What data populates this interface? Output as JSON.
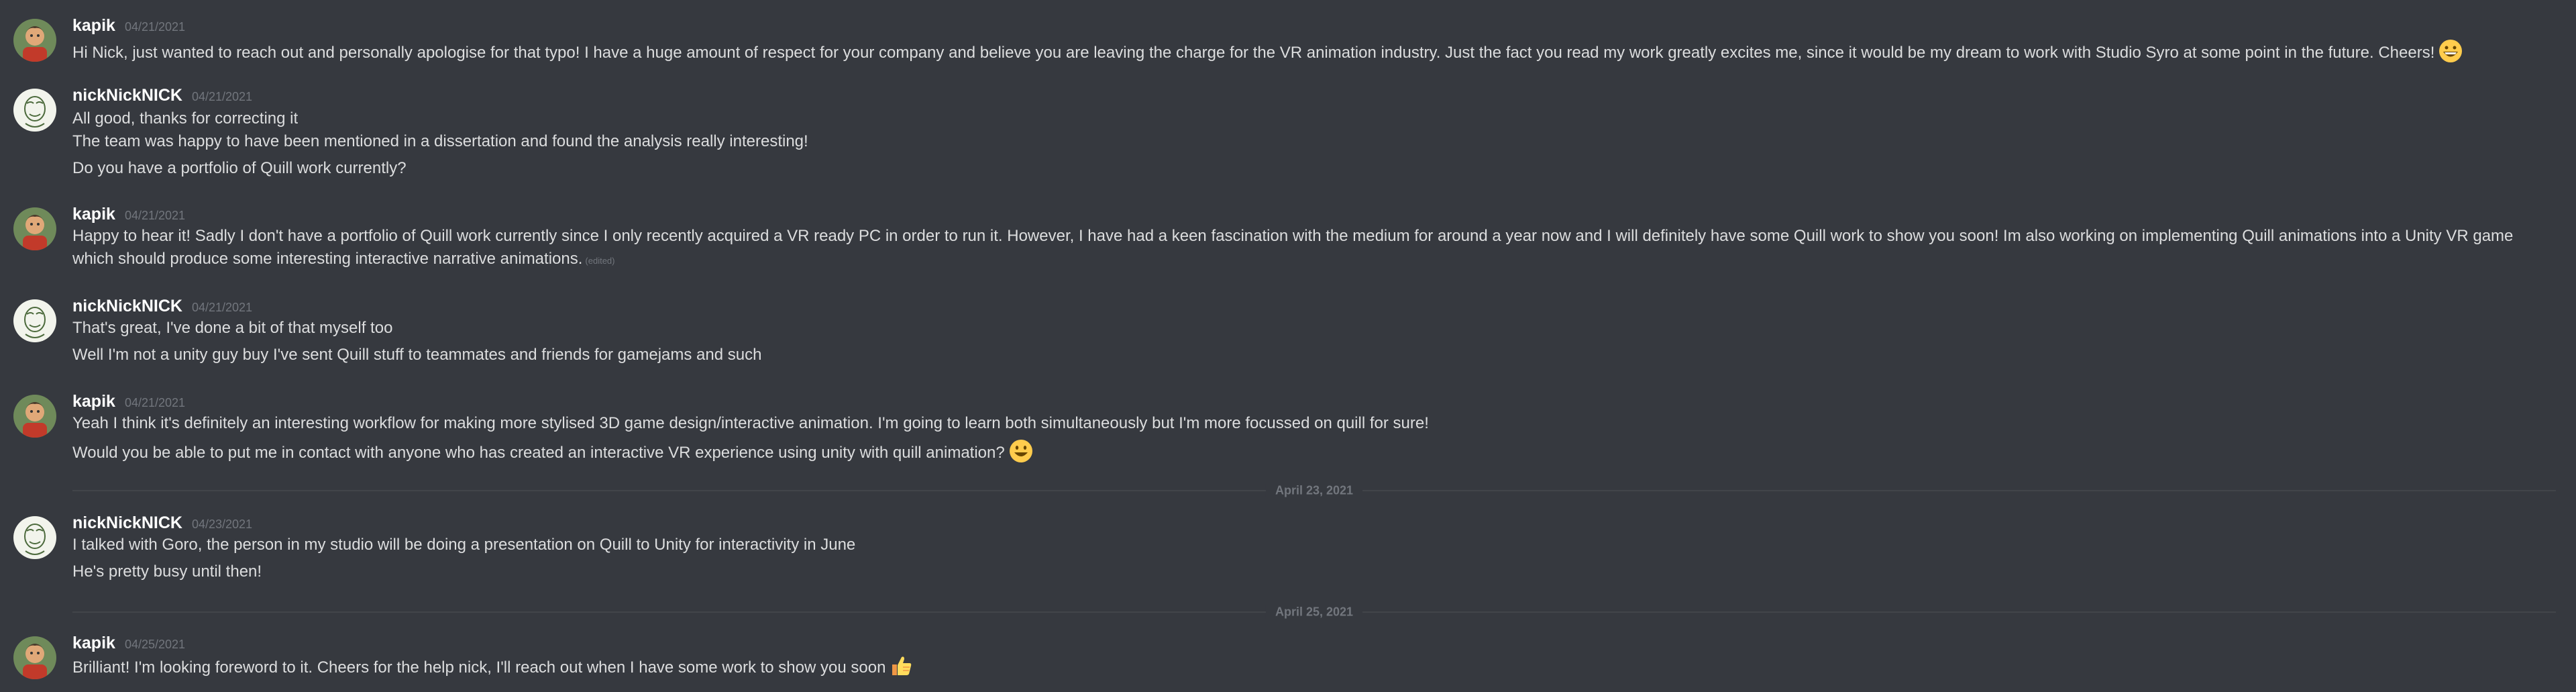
{
  "users": {
    "kapik": {
      "name": "kapik"
    },
    "nick": {
      "name": "nickNickNICK"
    }
  },
  "groups": [
    {
      "author": "kapik",
      "time": "04/21/2021",
      "lines": [
        "Hi Nick,  just wanted to reach out and personally apologise for that typo! I have a huge amount of respect for your company and believe you are leaving the charge for the VR animation industry. Just the fact you read my work greatly excites me, since it would be my dream to work with Studio Syro at some point in the future. Cheers!"
      ]
    },
    {
      "author": "nickNickNICK",
      "time": "04/21/2021",
      "lines": [
        "All good, thanks for correcting it",
        "The team was happy to have been mentioned in a dissertation and found the analysis really interesting!",
        "Do you have a portfolio of Quill work currently?"
      ]
    },
    {
      "author": "kapik",
      "time": "04/21/2021",
      "lines": [
        "Happy to hear it! Sadly I don't have a portfolio of Quill work currently since I only recently acquired a VR ready PC in order to run it. However, I have had a keen fascination with the medium for around a year now and I will definitely have some Quill work to show you soon! Im also working on implementing Quill animations into a Unity VR game which should produce some interesting interactive narrative animations."
      ],
      "edited": "(edited)"
    },
    {
      "author": "nickNickNICK",
      "time": "04/21/2021",
      "lines": [
        "That's great, I've done a bit of that myself too",
        "Well I'm not a unity guy buy I've sent Quill stuff to teammates and friends for gamejams and such"
      ]
    },
    {
      "author": "kapik",
      "time": "04/21/2021",
      "lines": [
        "Yeah I think it's definitely an interesting workflow for making more stylised 3D game design/interactive animation. I'm going to learn both simultaneously but I'm more focussed on quill for sure!",
        "Would you be able to put me in contact with anyone who has created an interactive VR experience using unity with quill animation?"
      ]
    },
    {
      "author": "nickNickNICK",
      "time": "04/23/2021",
      "lines": [
        "I talked with Goro, the person in my studio will be doing a presentation on Quill to Unity for interactivity in June",
        "He's pretty busy until then!"
      ]
    },
    {
      "author": "kapik",
      "time": "04/25/2021",
      "lines": [
        "Brilliant! I'm looking foreword to it. Cheers for the help nick, I'll reach out when I have some work to show you soon"
      ]
    }
  ],
  "dividers": [
    "April 23, 2021",
    "April 25, 2021"
  ],
  "emojis": {
    "grin": "grinning-face",
    "smiley": "smiling-face",
    "thumbs": "thumbs-up"
  },
  "colors": {
    "background": "#36393f",
    "text": "#dcddde",
    "username": "#ffffff",
    "timestamp": "#72767d",
    "divider": "#42454a"
  }
}
